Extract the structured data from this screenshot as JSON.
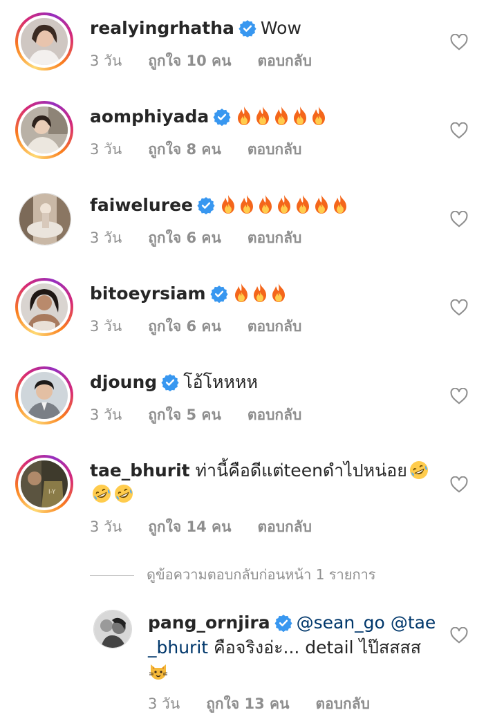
{
  "comments": [
    {
      "username": "realyingrhatha",
      "text": "Wow",
      "fires": 0,
      "time": "3 วัน",
      "likes": "ถูกใจ 10 คน",
      "reply": "ตอบกลับ"
    },
    {
      "username": "aomphiyada",
      "text": "",
      "fires": 5,
      "time": "3 วัน",
      "likes": "ถูกใจ 8 คน",
      "reply": "ตอบกลับ"
    },
    {
      "username": "faiweluree",
      "text": "",
      "fires": 7,
      "time": "3 วัน",
      "likes": "ถูกใจ 6 คน",
      "reply": "ตอบกลับ"
    },
    {
      "username": "bitoeyrsiam",
      "text": "",
      "fires": 3,
      "time": "3 วัน",
      "likes": "ถูกใจ 6 คน",
      "reply": "ตอบกลับ"
    },
    {
      "username": "djoung",
      "text": "โอ้โหหหห",
      "fires": 0,
      "time": "3 วัน",
      "likes": "ถูกใจ 5 คน",
      "reply": "ตอบกลับ"
    },
    {
      "username": "tae_bhurit",
      "text": "ท่านี้คือดีแต่teenดำไปหน่อย",
      "time": "3 วัน",
      "likes": "ถูกใจ 14 คน",
      "reply": "ตอบกลับ"
    }
  ],
  "view_replies": "ดูข้อความตอบกลับก่อนหน้า 1 รายการ",
  "reply": {
    "username": "pang_ornjira",
    "mention1": "@sean_go",
    "mention2_part1": "@tae",
    "mention2_part2": "_bhurit",
    "text": "คือจริงอ่ะ... detail ไป๊สสสส",
    "time": "3 วัน",
    "likes": "ถูกใจ 13 คน",
    "reply": "ตอบกลับ"
  },
  "icons": {
    "verified": "verified-badge-icon",
    "heart": "heart-outline-icon",
    "fire": "fire-emoji",
    "rofl": "rolling-laughing-emoji",
    "cat": "cat-emoji"
  },
  "colors": {
    "verified": "#3897f0",
    "secondary_text": "#8e8e8e",
    "mention": "#00376b"
  }
}
